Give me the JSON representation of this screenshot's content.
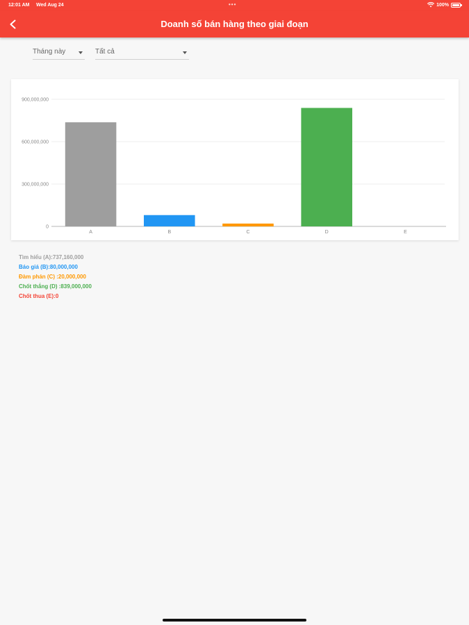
{
  "status_bar": {
    "time": "12:01 AM",
    "date": "Wed Aug 24",
    "battery": "100%",
    "battery_level": 1.0
  },
  "header": {
    "title": "Doanh số bán hàng theo giai đoạn",
    "back_icon": "chevron-left-icon"
  },
  "filters": {
    "period": "Tháng này",
    "scope": "Tất cả"
  },
  "chart_data": {
    "type": "bar",
    "categories": [
      "A",
      "B",
      "C",
      "D",
      "E"
    ],
    "values": [
      737160000,
      80000000,
      20000000,
      839000000,
      0
    ],
    "colors": [
      "#9e9e9e",
      "#2196f3",
      "#ff9800",
      "#4caf50",
      "#f44336"
    ],
    "ylim": [
      0,
      900000000
    ],
    "yticks": [
      0,
      300000000,
      600000000,
      900000000
    ],
    "ytick_labels": [
      "0",
      "300,000,000",
      "600,000,000",
      "900,000,000"
    ],
    "grid": true
  },
  "legend": [
    {
      "text": "Tìm hiểu (A):737,160,000",
      "color": "#9e9e9e"
    },
    {
      "text": "Báo giá (B):80,000,000",
      "color": "#2196f3"
    },
    {
      "text": "Đàm phán (C) :20,000,000",
      "color": "#ff9800"
    },
    {
      "text": "Chốt thắng (D) :839,000,000",
      "color": "#4caf50"
    },
    {
      "text": "Chốt thua (E):0",
      "color": "#f44336"
    }
  ]
}
